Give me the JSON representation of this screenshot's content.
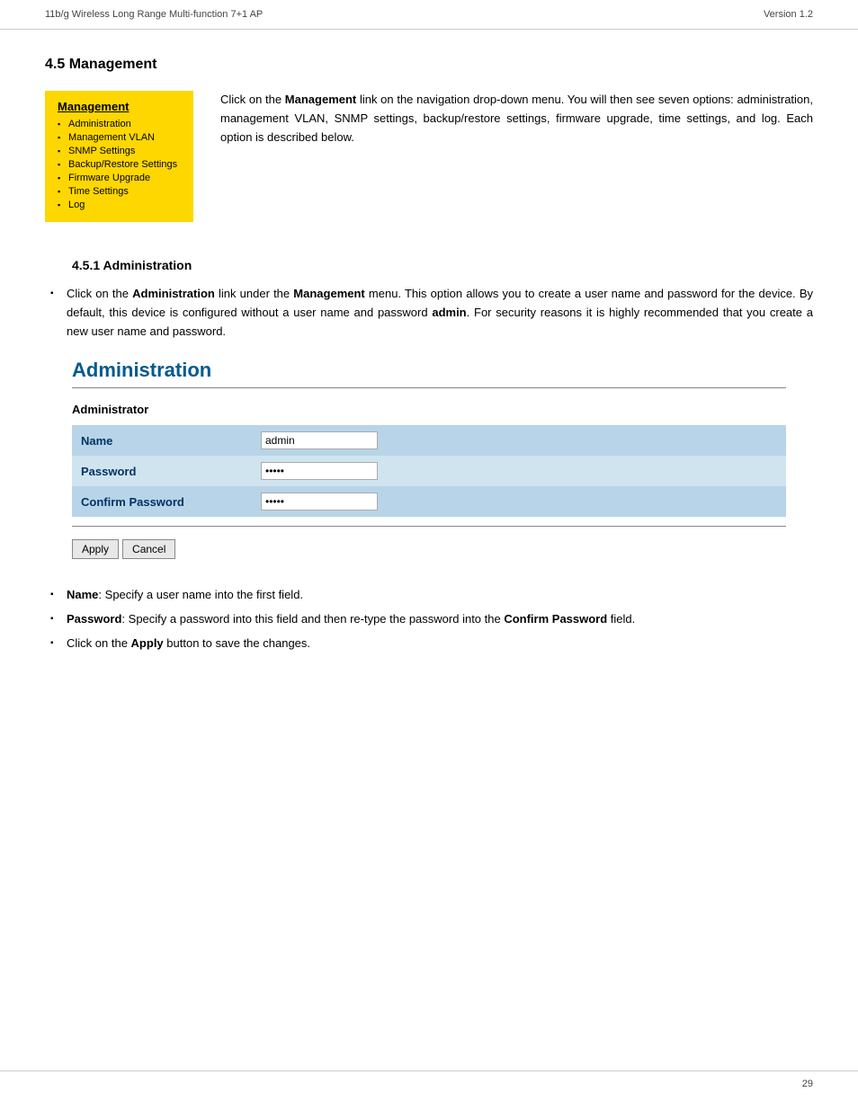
{
  "header": {
    "left": "11b/g Wireless Long Range Multi-function 7+1 AP",
    "right": "Version 1.2"
  },
  "footer": {
    "page_number": "29"
  },
  "section_45": {
    "title": "4.5  Management",
    "management_box": {
      "title": "Management",
      "items": [
        "Administration",
        "Management VLAN",
        "SNMP Settings",
        "Backup/Restore Settings",
        "Firmware Upgrade",
        "Time Settings",
        "Log"
      ]
    },
    "description": "Click on the Management link on the navigation drop-down menu. You will then see seven options: administration, management VLAN, SNMP settings, backup/restore settings, firmware upgrade, time settings, and log. Each option is described below."
  },
  "section_451": {
    "title": "4.5.1  Administration",
    "intro_bullet": "Click on the Administration link under the Management menu. This option allows you to create a user name and password for the device. By default, this device is configured without a user name and password admin. For security reasons it is highly recommended that you create a new user name and password.",
    "admin_panel": {
      "title": "Administration",
      "section_label": "Administrator",
      "fields": [
        {
          "label": "Name",
          "value": "admin",
          "type": "text"
        },
        {
          "label": "Password",
          "value": "•••••",
          "type": "password"
        },
        {
          "label": "Confirm Password",
          "value": "•••••",
          "type": "password"
        }
      ],
      "buttons": [
        "Apply",
        "Cancel"
      ]
    },
    "bullets": [
      {
        "text_parts": [
          {
            "bold": true,
            "text": "Name"
          },
          {
            "bold": false,
            "text": ": Specify a user name into the first field."
          }
        ]
      },
      {
        "text_parts": [
          {
            "bold": true,
            "text": "Password"
          },
          {
            "bold": false,
            "text": ": Specify a password into this field and then re-type the password into the "
          },
          {
            "bold": true,
            "text": "Confirm Password"
          },
          {
            "bold": false,
            "text": " field."
          }
        ]
      },
      {
        "text_parts": [
          {
            "bold": false,
            "text": "Click on the "
          },
          {
            "bold": true,
            "text": "Apply"
          },
          {
            "bold": false,
            "text": " button to save the changes."
          }
        ]
      }
    ]
  }
}
